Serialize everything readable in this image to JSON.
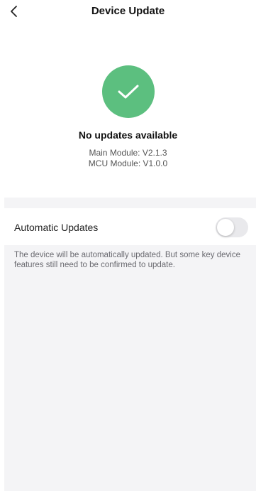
{
  "header": {
    "title": "Device Update",
    "back_icon": "chevron-left-icon"
  },
  "status": {
    "icon": "checkmark-icon",
    "icon_color": "#5cbf7f",
    "title": "No updates available",
    "main_module": "Main Module: V2.1.3",
    "mcu_module": "MCU Module: V1.0.0"
  },
  "settings": {
    "auto_update_label": "Automatic Updates",
    "auto_update_enabled": false,
    "note": "The device will be automatically updated. But some key device features still need to be confirmed to update."
  }
}
